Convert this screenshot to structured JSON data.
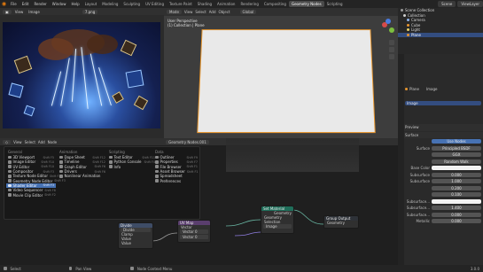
{
  "topbar": {
    "menus": [
      "File",
      "Edit",
      "Render",
      "Window",
      "Help"
    ],
    "tabs": [
      "Layout",
      "Modeling",
      "Sculpting",
      "UV Editing",
      "Texture Paint",
      "Shading",
      "Animation",
      "Rendering",
      "Compositing",
      "Geometry Nodes",
      "Scripting"
    ],
    "active_tab": "Geometry Nodes",
    "scene_label": "Scene",
    "view_layer_label": "ViewLayer"
  },
  "image_editor": {
    "menus": [
      "View",
      "Image"
    ],
    "image_name": "7.png"
  },
  "viewport": {
    "mode": "Mode",
    "menus": [
      "View",
      "Select",
      "Add",
      "Object"
    ],
    "orientation": "Global",
    "title_line1": "User Perspective",
    "title_line2": "(1) Collection | Plane"
  },
  "outliner": {
    "rows": [
      {
        "label": "Scene Collection",
        "selected": false
      },
      {
        "label": "Collection",
        "selected": false
      },
      {
        "label": "Camera",
        "selected": false
      },
      {
        "label": "Cube",
        "selected": false
      },
      {
        "label": "Light",
        "selected": false
      },
      {
        "label": "Plane",
        "selected": true
      }
    ]
  },
  "properties": {
    "object_name": "Plane",
    "material_name": "Image",
    "slot_name": "Image",
    "preview_label": "Preview",
    "surface_label": "Surface",
    "use_nodes_label": "Use Nodes",
    "surface_value": "Principled BSDF",
    "rows": [
      {
        "label": "",
        "value": "GGX"
      },
      {
        "label": "",
        "value": "Random Walk"
      },
      {
        "label": "Base Color",
        "value": ""
      },
      {
        "label": "Subsurface",
        "value": "0.000"
      },
      {
        "label": "Subsurface",
        "value": "1.000"
      },
      {
        "label": "",
        "value": "0.200"
      },
      {
        "label": "",
        "value": "0.100"
      },
      {
        "label": "Subsurface...",
        "value": ""
      },
      {
        "label": "Subsurface...",
        "value": "1.400"
      },
      {
        "label": "Subsurface...",
        "value": "0.000"
      },
      {
        "label": "Metallic",
        "value": "0.000"
      }
    ]
  },
  "node_editor": {
    "editor_name": "Geometry Nodes.001",
    "menus": [
      "View",
      "Select",
      "Add",
      "Node"
    ],
    "nodes": {
      "set_material": {
        "title": "Set Material",
        "rows": [
          "Geometry",
          "Geometry",
          "Selection",
          "Image"
        ]
      },
      "group_output": {
        "title": "Group Output",
        "rows": [
          "Geometry"
        ]
      },
      "divide": {
        "title": "Divide",
        "rows": [
          "Divide",
          "Clamp",
          "Value",
          "Value"
        ]
      },
      "uv_map": {
        "title": "UV Map",
        "rows": [
          "Vector",
          "Vector 0",
          "Vector 0"
        ]
      }
    }
  },
  "add_menu": {
    "columns": [
      {
        "title": "General",
        "items": [
          {
            "label": "3D Viewport",
            "shortcut": "Shift F5"
          },
          {
            "label": "Image Editor",
            "shortcut": "Shift F10"
          },
          {
            "label": "UV Editor",
            "shortcut": "Shift F10"
          },
          {
            "label": "Compositor",
            "shortcut": "Shift F3"
          },
          {
            "label": "Texture Node Editor",
            "shortcut": "Shift F3"
          },
          {
            "label": "Geometry Node Editor",
            "shortcut": "Shift F3"
          },
          {
            "label": "Shader Editor",
            "shortcut": "Shift F3",
            "highlight": true
          },
          {
            "label": "Video Sequencer",
            "shortcut": "Shift F8"
          },
          {
            "label": "Movie Clip Editor",
            "shortcut": "Shift F2"
          }
        ]
      },
      {
        "title": "Animation",
        "items": [
          {
            "label": "Dope Sheet",
            "shortcut": "Shift F12"
          },
          {
            "label": "Timeline",
            "shortcut": "Shift F12"
          },
          {
            "label": "Graph Editor",
            "shortcut": "Shift F6"
          },
          {
            "label": "Drivers",
            "shortcut": "Shift F6"
          },
          {
            "label": "Nonlinear Animation",
            "shortcut": ""
          }
        ]
      },
      {
        "title": "Scripting",
        "items": [
          {
            "label": "Text Editor",
            "shortcut": "Shift F11"
          },
          {
            "label": "Python Console",
            "shortcut": "Shift F4"
          },
          {
            "label": "Info",
            "shortcut": ""
          }
        ]
      },
      {
        "title": "Data",
        "items": [
          {
            "label": "Outliner",
            "shortcut": "Shift F9"
          },
          {
            "label": "Properties",
            "shortcut": "Shift F7"
          },
          {
            "label": "File Browser",
            "shortcut": "Shift F1"
          },
          {
            "label": "Asset Browser",
            "shortcut": "Shift F1"
          },
          {
            "label": "Spreadsheet",
            "shortcut": ""
          },
          {
            "label": "Preferences",
            "shortcut": ""
          }
        ]
      }
    ]
  },
  "statusbar": {
    "items": [
      "Select",
      "Pan View",
      "Node Context Menu"
    ],
    "version": "3.0.0"
  },
  "colors": {
    "accent": "#4772b3",
    "active_orange": "#e8962e",
    "node_geometry_header": "#1f6e5a",
    "node_math_header": "#3e4c66"
  }
}
